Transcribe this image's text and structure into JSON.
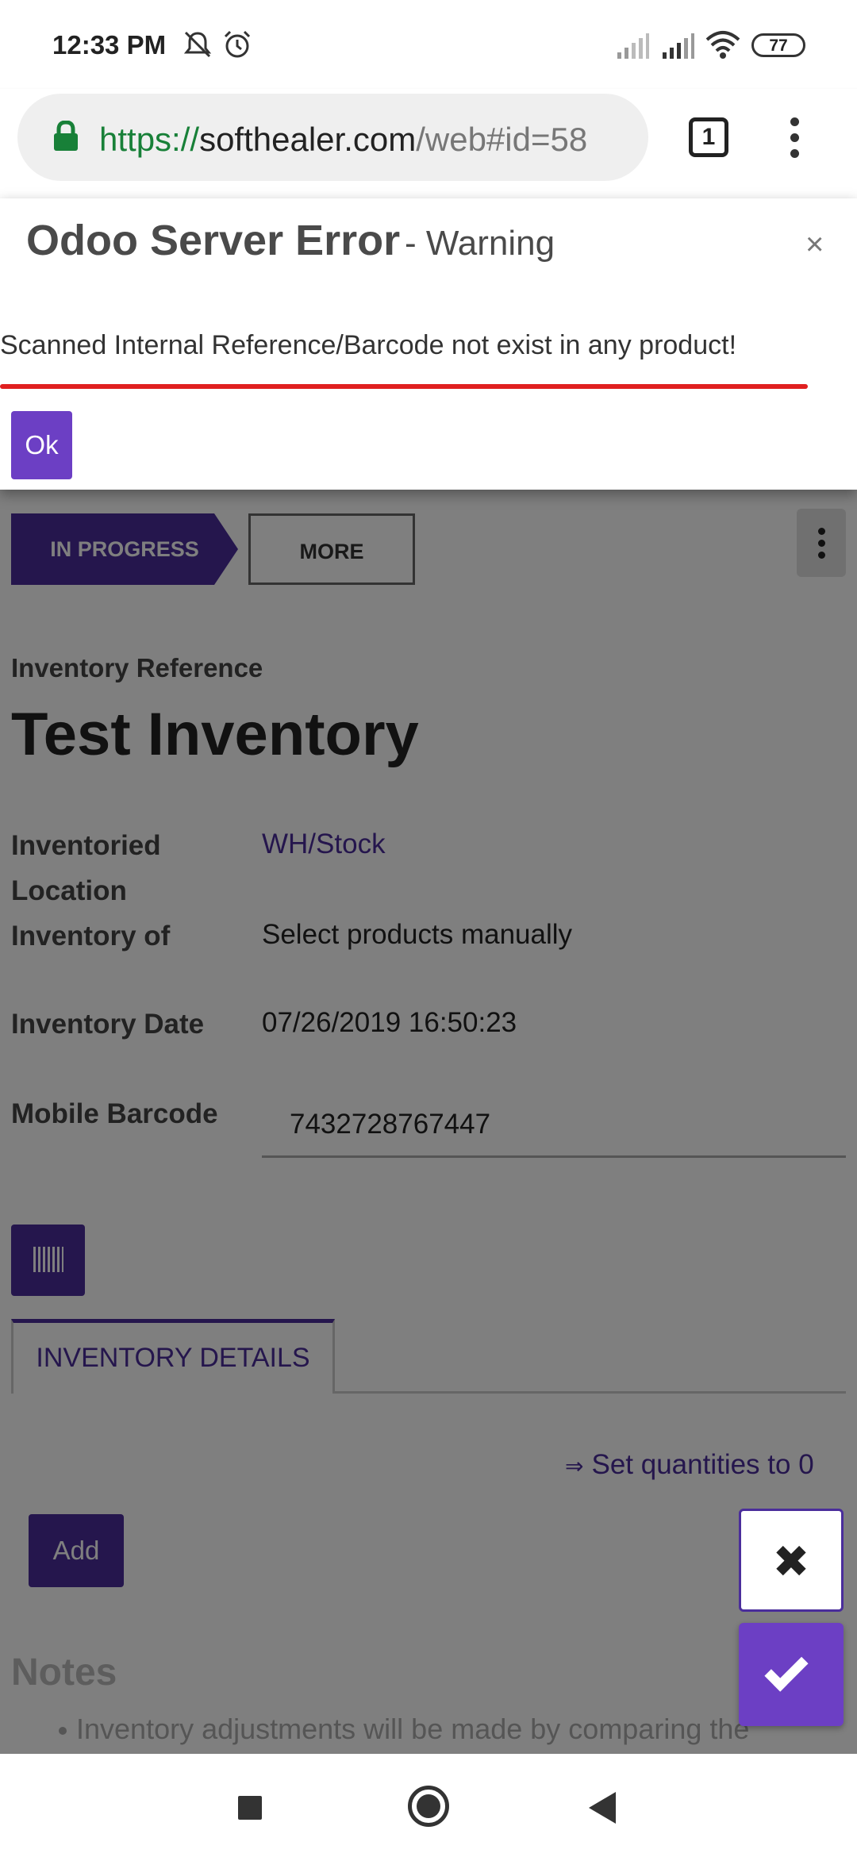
{
  "status_bar": {
    "time": "12:33 PM",
    "battery": "77",
    "icons": [
      "mute-icon",
      "alarm-icon",
      "signal-icon",
      "signal-icon",
      "wifi-icon",
      "battery-icon"
    ]
  },
  "browser": {
    "url_scheme": "https://",
    "url_domain": "softhealer.com",
    "url_path": "/web#id=58",
    "tab_count": "1"
  },
  "dialog": {
    "title": "Odoo Server Error",
    "subtitle": "- Warning",
    "close": "×",
    "message": "Scanned Internal Reference/Barcode not exist in any product!",
    "ok_label": "Ok"
  },
  "form": {
    "status_in_progress": "IN PROGRESS",
    "more_label": "MORE",
    "reference_label": "Inventory Reference",
    "title": "Test Inventory",
    "location_label_1": "Inventoried",
    "location_label_2": "Location",
    "location_value": "WH/Stock",
    "inventory_of_label": "Inventory of",
    "inventory_of_value": "Select products manually",
    "date_label": "Inventory Date",
    "date_value": "07/26/2019 16:50:23",
    "barcode_label": "Mobile Barcode",
    "barcode_value": "7432728767447",
    "tab_details": "INVENTORY DETAILS",
    "set_quantities_arrow": "⇒",
    "set_quantities": "Set quantities to 0",
    "add_label": "Add",
    "notes_title": "Notes",
    "notes_line": "Inventory adjustments will be made by comparing the"
  },
  "colors": {
    "brand": "#4a2d9b",
    "accent": "#6c3fc4",
    "error_line": "#e02020"
  }
}
